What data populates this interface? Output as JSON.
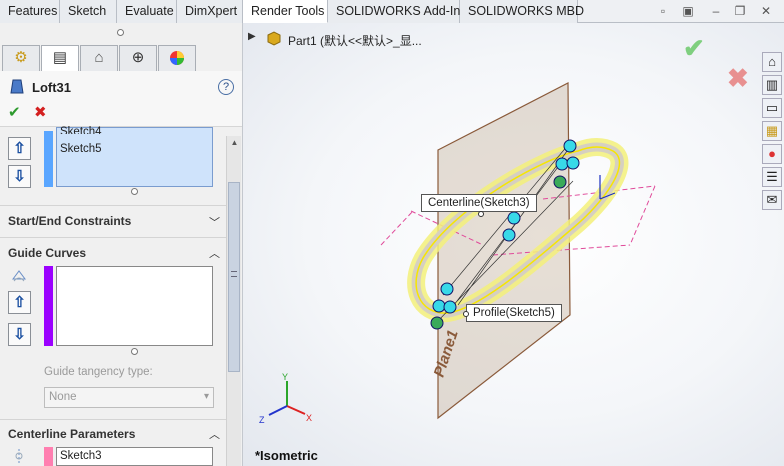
{
  "tabs": [
    "Features",
    "Sketch",
    "Evaluate",
    "DimXpert",
    "Render Tools",
    "SOLIDWORKS Add-Ins",
    "SOLIDWORKS MBD"
  ],
  "active_tab": "Render Tools",
  "panel_tab_icons": [
    "feature-manager-icon",
    "property-manager-icon",
    "configuration-manager-icon",
    "dimxpert-manager-icon",
    "display-manager-icon"
  ],
  "feature": {
    "name": "Loft31",
    "ok": "✔",
    "cancel": "✖",
    "help": "?"
  },
  "profiles": {
    "partial_item": "Sketch4",
    "item": "Sketch5"
  },
  "sections": {
    "start_end": "Start/End Constraints",
    "guide_curves": "Guide Curves",
    "guide_tangency_label": "Guide tangency type:",
    "guide_tangency_value": "None",
    "centerline": "Centerline Parameters",
    "centerline_value": "Sketch3"
  },
  "tree": {
    "part_label": "Part1  (默认<<默认>_显..."
  },
  "callouts": {
    "centerline": "Centerline(Sketch3)",
    "profile": "Profile(Sketch5)",
    "plane": "Plane1"
  },
  "view_label": "*Isometric",
  "triad": {
    "x": "X",
    "y": "Y",
    "z": "Z"
  },
  "colors": {
    "profile_bar": "#5aa6ff",
    "guide_bar": "#9b00ff",
    "centerline_bar": "#ff7fb0",
    "accept": "#7fcf7f",
    "reject": "#e87f7f"
  }
}
